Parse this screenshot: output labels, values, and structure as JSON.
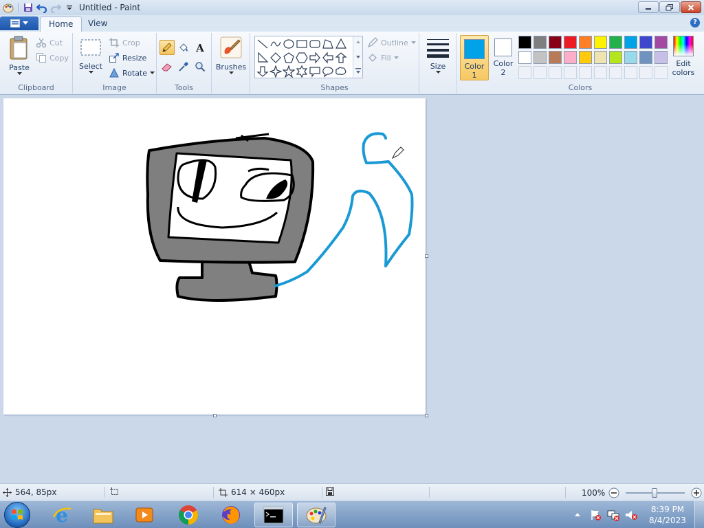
{
  "window": {
    "title": "Untitled - Paint"
  },
  "tabs": {
    "file_label": "",
    "home": "Home",
    "view": "View"
  },
  "clipboard": {
    "paste": "Paste",
    "cut": "Cut",
    "copy": "Copy",
    "group": "Clipboard"
  },
  "image": {
    "select": "Select",
    "crop": "Crop",
    "resize": "Resize",
    "rotate": "Rotate",
    "group": "Image"
  },
  "tools": {
    "group": "Tools"
  },
  "brushes": {
    "label": "Brushes"
  },
  "shapes": {
    "outline": "Outline",
    "fill": "Fill",
    "group": "Shapes"
  },
  "size": {
    "label": "Size"
  },
  "colors": {
    "color1_line1": "Color",
    "color1_line2": "1",
    "color2_line1": "Color",
    "color2_line2": "2",
    "edit_line1": "Edit",
    "edit_line2": "colors",
    "group": "Colors",
    "color1_value": "#00a2e8",
    "color2_value": "#ffffff",
    "palette_row1": [
      "#000000",
      "#7f7f7f",
      "#880015",
      "#ed1c24",
      "#ff7f27",
      "#fff200",
      "#22b14c",
      "#00a2e8",
      "#3f48cc",
      "#a349a4"
    ],
    "palette_row2": [
      "#ffffff",
      "#c3c3c3",
      "#b97a57",
      "#ffaec9",
      "#ffc90e",
      "#efe4b0",
      "#b5e61d",
      "#99d9ea",
      "#7092be",
      "#c8bfe7"
    ]
  },
  "status": {
    "cursor_pos": "564, 85px",
    "canvas_size": "614 × 460px",
    "zoom": "100%"
  },
  "taskbar": {
    "time": "8:39 PM",
    "date": "8/4/2023"
  }
}
